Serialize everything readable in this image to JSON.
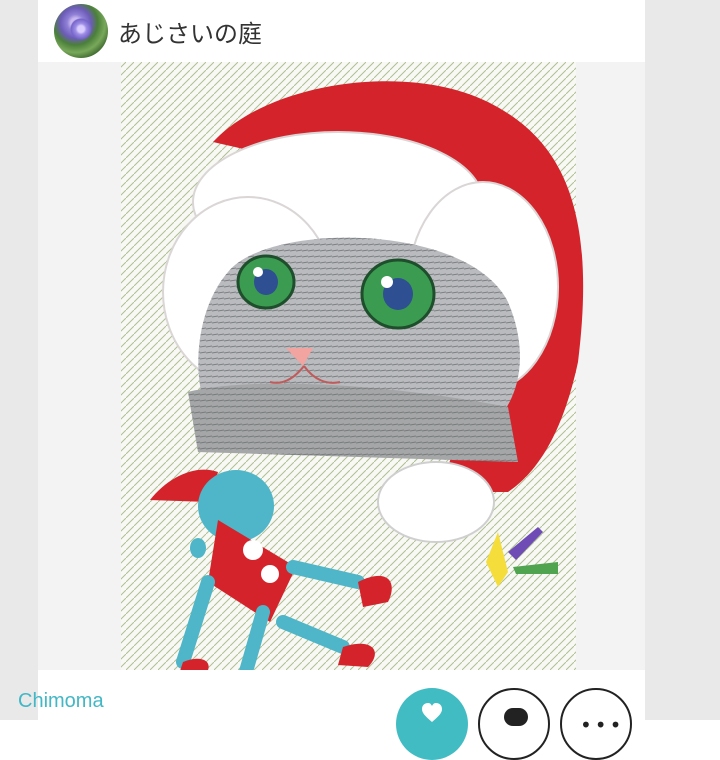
{
  "header": {
    "title": "あじさいの庭",
    "avatar_icon": "hydrangea-avatar-icon"
  },
  "post": {
    "image_icon": "crayon-drawing-cat-santa-hat"
  },
  "footer": {
    "author": "Chimoma",
    "buttons": [
      {
        "name": "like",
        "icon": "heart-icon"
      },
      {
        "name": "comment",
        "icon": "comment-icon"
      },
      {
        "name": "more",
        "icon": "more-icon"
      }
    ]
  },
  "colors": {
    "accent": "#42bcc3",
    "author_text": "#42b7c5",
    "page_bg": "#ffffff",
    "side_bg": "#e9e9e9"
  }
}
